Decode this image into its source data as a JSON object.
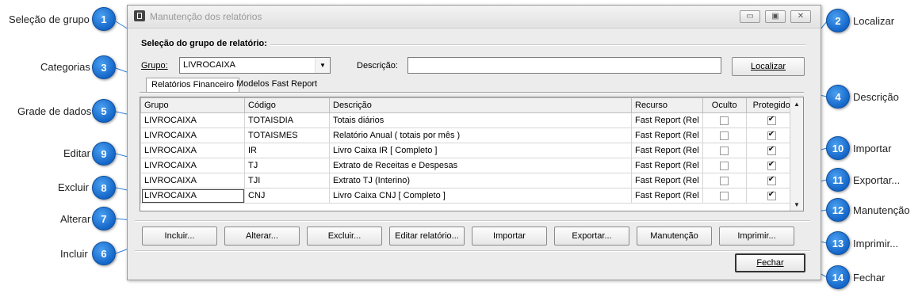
{
  "window": {
    "title": "Manutenção dos relatórios",
    "controls": [
      "minimize-icon",
      "maximize-icon",
      "close-icon"
    ]
  },
  "group": {
    "caption": "Seleção do grupo de relatório:",
    "group_label": "Grupo:",
    "group_value": "LIVROCAIXA",
    "description_label": "Descrição:",
    "description_value": "",
    "search_button": "Localizar"
  },
  "tabs": [
    "Relatórios Financeiro",
    "Modelos Fast Report"
  ],
  "grid": {
    "columns": [
      "Grupo",
      "Código",
      "Descrição",
      "Recurso",
      "Oculto",
      "Protegido"
    ],
    "rows": [
      {
        "grupo": "LIVROCAIXA",
        "codigo": "TOTAISDIA",
        "descricao": "Totais diários",
        "recurso": "Fast Report (Rel",
        "oculto": false,
        "protegido": true
      },
      {
        "grupo": "LIVROCAIXA",
        "codigo": "TOTAISMES",
        "descricao": "Relatório Anual ( totais por mês )",
        "recurso": "Fast Report (Rel",
        "oculto": false,
        "protegido": true
      },
      {
        "grupo": "LIVROCAIXA",
        "codigo": "IR",
        "descricao": "Livro Caixa IR [ Completo ]",
        "recurso": "Fast Report (Rel",
        "oculto": false,
        "protegido": true
      },
      {
        "grupo": "LIVROCAIXA",
        "codigo": "TJ",
        "descricao": "Extrato de Receitas e Despesas",
        "recurso": "Fast Report (Rel",
        "oculto": false,
        "protegido": true
      },
      {
        "grupo": "LIVROCAIXA",
        "codigo": "TJI",
        "descricao": "Extrato TJ (Interino)",
        "recurso": "Fast Report (Rel",
        "oculto": false,
        "protegido": true
      },
      {
        "grupo": "LIVROCAIXA",
        "codigo": "CNJ",
        "descricao": "Livro Caixa CNJ [ Completo ]",
        "recurso": "Fast Report (Rel",
        "oculto": false,
        "protegido": true
      }
    ]
  },
  "buttons": {
    "incluir": "Incluir...",
    "alterar": "Alterar...",
    "excluir": "Excluir...",
    "editar": "Editar relatório...",
    "importar": "Importar",
    "exportar": "Exportar...",
    "manutencao": "Manutenção",
    "imprimir": "Imprimir...",
    "fechar": "Fechar"
  },
  "callouts": [
    {
      "num": "1",
      "label": "Seleção de grupo"
    },
    {
      "num": "2",
      "label": "Localizar"
    },
    {
      "num": "3",
      "label": "Categorias"
    },
    {
      "num": "4",
      "label": "Descrição"
    },
    {
      "num": "5",
      "label": "Grade de dados"
    },
    {
      "num": "6",
      "label": "Incluir"
    },
    {
      "num": "7",
      "label": "Alterar"
    },
    {
      "num": "8",
      "label": "Excluir"
    },
    {
      "num": "9",
      "label": "Editar"
    },
    {
      "num": "10",
      "label": "Importar"
    },
    {
      "num": "11",
      "label": "Exportar..."
    },
    {
      "num": "12",
      "label": "Manutenção"
    },
    {
      "num": "13",
      "label": "Imprimir..."
    },
    {
      "num": "14",
      "label": "Fechar"
    }
  ],
  "colors": {
    "badge": "#1466c8",
    "callout_line": "#2f7fd6"
  }
}
